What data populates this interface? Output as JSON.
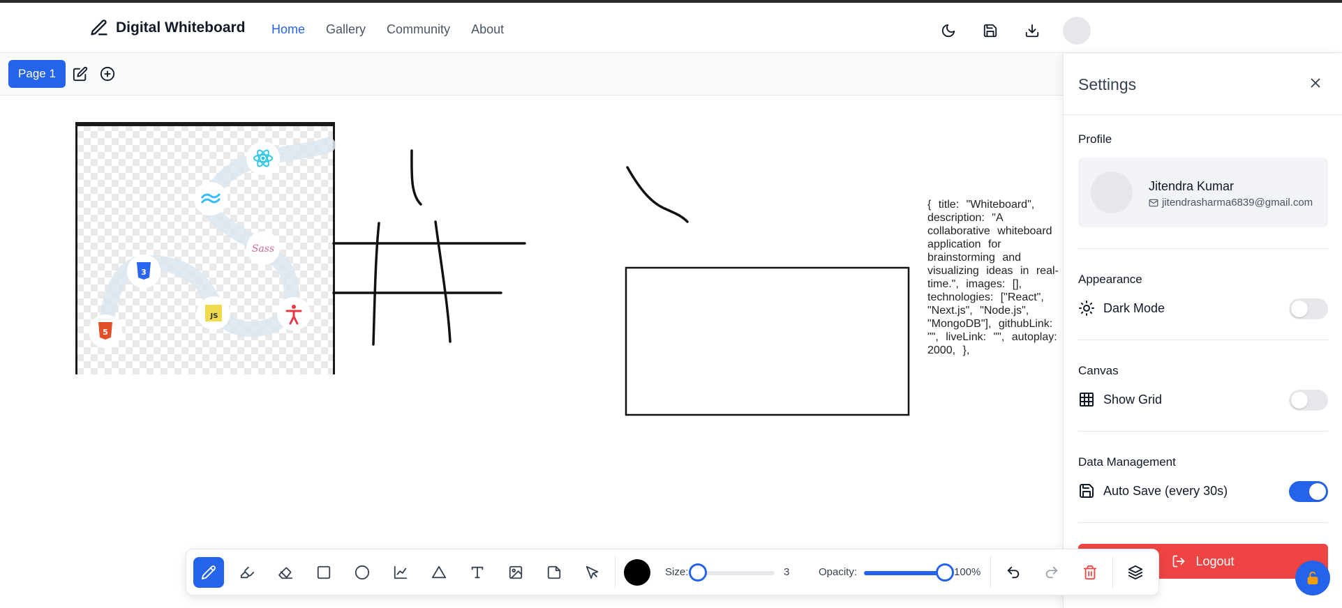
{
  "navbar": {
    "title": "Digital Whiteboard",
    "links": [
      {
        "label": "Home",
        "active": true
      },
      {
        "label": "Gallery",
        "active": false
      },
      {
        "label": "Community",
        "active": false
      },
      {
        "label": "About",
        "active": false
      }
    ],
    "actions": [
      "moon-icon",
      "save-icon",
      "download-icon",
      "avatar"
    ]
  },
  "pagebar": {
    "current_page": "Page 1",
    "actions": [
      "edit-icon",
      "plus-circle-icon"
    ]
  },
  "canvas": {
    "text_note": "{     title: \"Whiteboard\",     description:        \"A collaborative whiteboard application for brainstorming and visualizing ideas in real-time.\",     images: [],     technologies: [\"React\", \"Next.js\", \"Node.js\", \"MongoDB\"],     githubLink: \"\",     liveLink: \"\",     autoplay: 2000,   },",
    "image_icons": [
      "react-icon",
      "tailwind-icon",
      "sass-icon",
      "css3-icon",
      "js-icon",
      "accessibility-icon",
      "html5-icon"
    ],
    "image_labels": {
      "js": "JS",
      "sass": "Sass"
    }
  },
  "settings": {
    "title": "Settings",
    "profile": {
      "label": "Profile",
      "name": "Jitendra Kumar",
      "email": "jitendrasharma6839@gmail.com"
    },
    "appearance": {
      "label": "Appearance",
      "dark_mode_label": "Dark Mode",
      "dark_mode": false
    },
    "canvas": {
      "label": "Canvas",
      "show_grid_label": "Show Grid",
      "show_grid": false
    },
    "data": {
      "label": "Data Management",
      "auto_save_label": "Auto Save (every 30s)",
      "auto_save": true
    },
    "logout_label": "Logout"
  },
  "toolbar": {
    "tools": [
      "pencil-icon",
      "highlighter-icon",
      "eraser-icon",
      "rectangle-icon",
      "circle-icon",
      "line-chart-icon",
      "triangle-icon",
      "text-icon",
      "image-icon",
      "sticky-note-icon",
      "select-pointer-icon"
    ],
    "active_tool": "pencil-icon",
    "color": "#000000",
    "size_label": "Size:",
    "size_value": "3",
    "size_level": 0.05,
    "opacity_label": "Opacity:",
    "opacity_value": "100%",
    "opacity_level": 1.0,
    "actions": [
      "undo-icon",
      "redo-icon",
      "trash-icon",
      "layers-icon"
    ]
  },
  "colors": {
    "accent": "#2563eb",
    "danger": "#ef4444",
    "muted_text": "#4b5563"
  }
}
